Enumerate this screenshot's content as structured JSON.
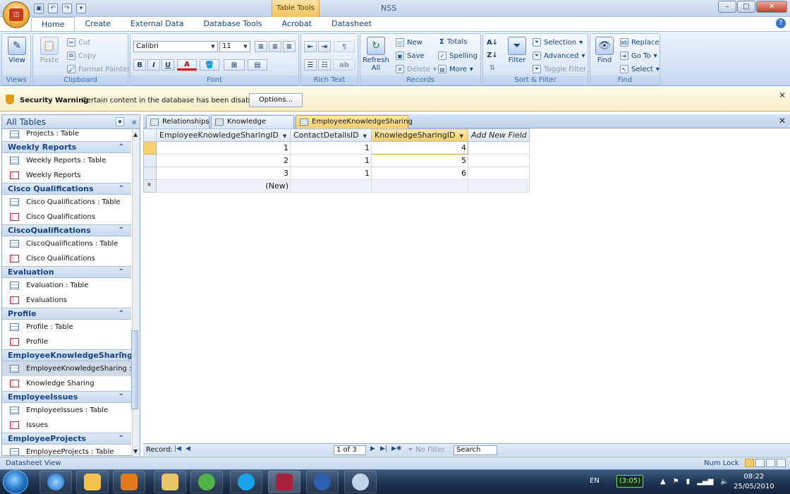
{
  "window": {
    "title": "NSS",
    "context_tab": "Table Tools"
  },
  "ribbon_tabs": [
    "Home",
    "Create",
    "External Data",
    "Database Tools",
    "Acrobat",
    "Datasheet"
  ],
  "groups": {
    "views": {
      "label": "Views",
      "view": "View"
    },
    "clipboard": {
      "label": "Clipboard",
      "paste": "Paste",
      "cut": "Cut",
      "copy": "Copy",
      "format_painter": "Format Painter"
    },
    "font": {
      "label": "Font",
      "font_name": "Calibri",
      "font_size": "11",
      "bold": "B",
      "italic": "I",
      "underline": "U",
      "font_color": "A"
    },
    "rich_text": {
      "label": "Rich Text"
    },
    "records": {
      "label": "Records",
      "refresh_line1": "Refresh",
      "refresh_line2": "All",
      "new": "New",
      "save": "Save",
      "delete": "Delete",
      "totals": "Totals",
      "spelling": "Spelling",
      "more": "More"
    },
    "sort_filter": {
      "label": "Sort & Filter",
      "filter": "Filter",
      "selection": "Selection",
      "advanced": "Advanced",
      "toggle_filter": "Toggle Filter"
    },
    "find": {
      "label": "Find",
      "find": "Find",
      "replace": "Replace",
      "goto": "Go To",
      "select": "Select"
    }
  },
  "security": {
    "title": "Security Warning",
    "message": "Certain content in the database has been disabled",
    "button": "Options..."
  },
  "nav": {
    "header": "All Tables",
    "top_item": "Projects : Table",
    "groups": [
      {
        "name": "Weekly Reports",
        "items": [
          {
            "label": "Weekly Reports : Table",
            "kind": "table"
          },
          {
            "label": "Weekly Reports",
            "kind": "form"
          }
        ]
      },
      {
        "name": "Cisco Qualifications",
        "items": [
          {
            "label": "Cisco Qualifications : Table",
            "kind": "table"
          },
          {
            "label": "Cisco Qualifications",
            "kind": "form"
          }
        ]
      },
      {
        "name": "CiscoQualifications",
        "items": [
          {
            "label": "CiscoQualifications : Table",
            "kind": "table"
          },
          {
            "label": "Cisco Qualifications",
            "kind": "form"
          }
        ]
      },
      {
        "name": "Evaluation",
        "items": [
          {
            "label": "Evaluation : Table",
            "kind": "table"
          },
          {
            "label": "Evaluations",
            "kind": "form"
          }
        ]
      },
      {
        "name": "Profile",
        "items": [
          {
            "label": "Profile : Table",
            "kind": "table"
          },
          {
            "label": "Profile",
            "kind": "form"
          }
        ]
      },
      {
        "name": "EmployeeKnowledgeSharing",
        "items": [
          {
            "label": "EmployeeKnowledgeSharing :...",
            "kind": "table"
          },
          {
            "label": "Knowledge Sharing",
            "kind": "form"
          }
        ]
      },
      {
        "name": "EmployeeIssues",
        "items": [
          {
            "label": "EmployeeIssues : Table",
            "kind": "table"
          },
          {
            "label": "Issues",
            "kind": "form"
          }
        ]
      },
      {
        "name": "EmployeeProjects",
        "items": [
          {
            "label": "EmployeeProjects : Table",
            "kind": "table"
          }
        ]
      }
    ]
  },
  "doc_tabs": [
    "Relationships",
    "Knowledge Sharing",
    "EmployeeKnowledgeSharing"
  ],
  "datasheet": {
    "columns": [
      "EmployeeKnowledgeSharingID",
      "ContactDetailsID",
      "KnowledgeSharingID",
      "Add New Field"
    ],
    "rows": [
      [
        "1",
        "1",
        "4"
      ],
      [
        "2",
        "1",
        "5"
      ],
      [
        "3",
        "1",
        "6"
      ]
    ],
    "new_row": "(New)",
    "new_marker": "*"
  },
  "record_nav": {
    "label": "Record:",
    "position": "1 of 3",
    "no_filter": "No Filter",
    "search": "Search"
  },
  "status": {
    "left": "Datasheet View",
    "right": "Num Lock"
  },
  "taskbar": {
    "lang": "EN",
    "battery": "(3:05)",
    "time": "08:22",
    "date": "25/05/2010"
  }
}
